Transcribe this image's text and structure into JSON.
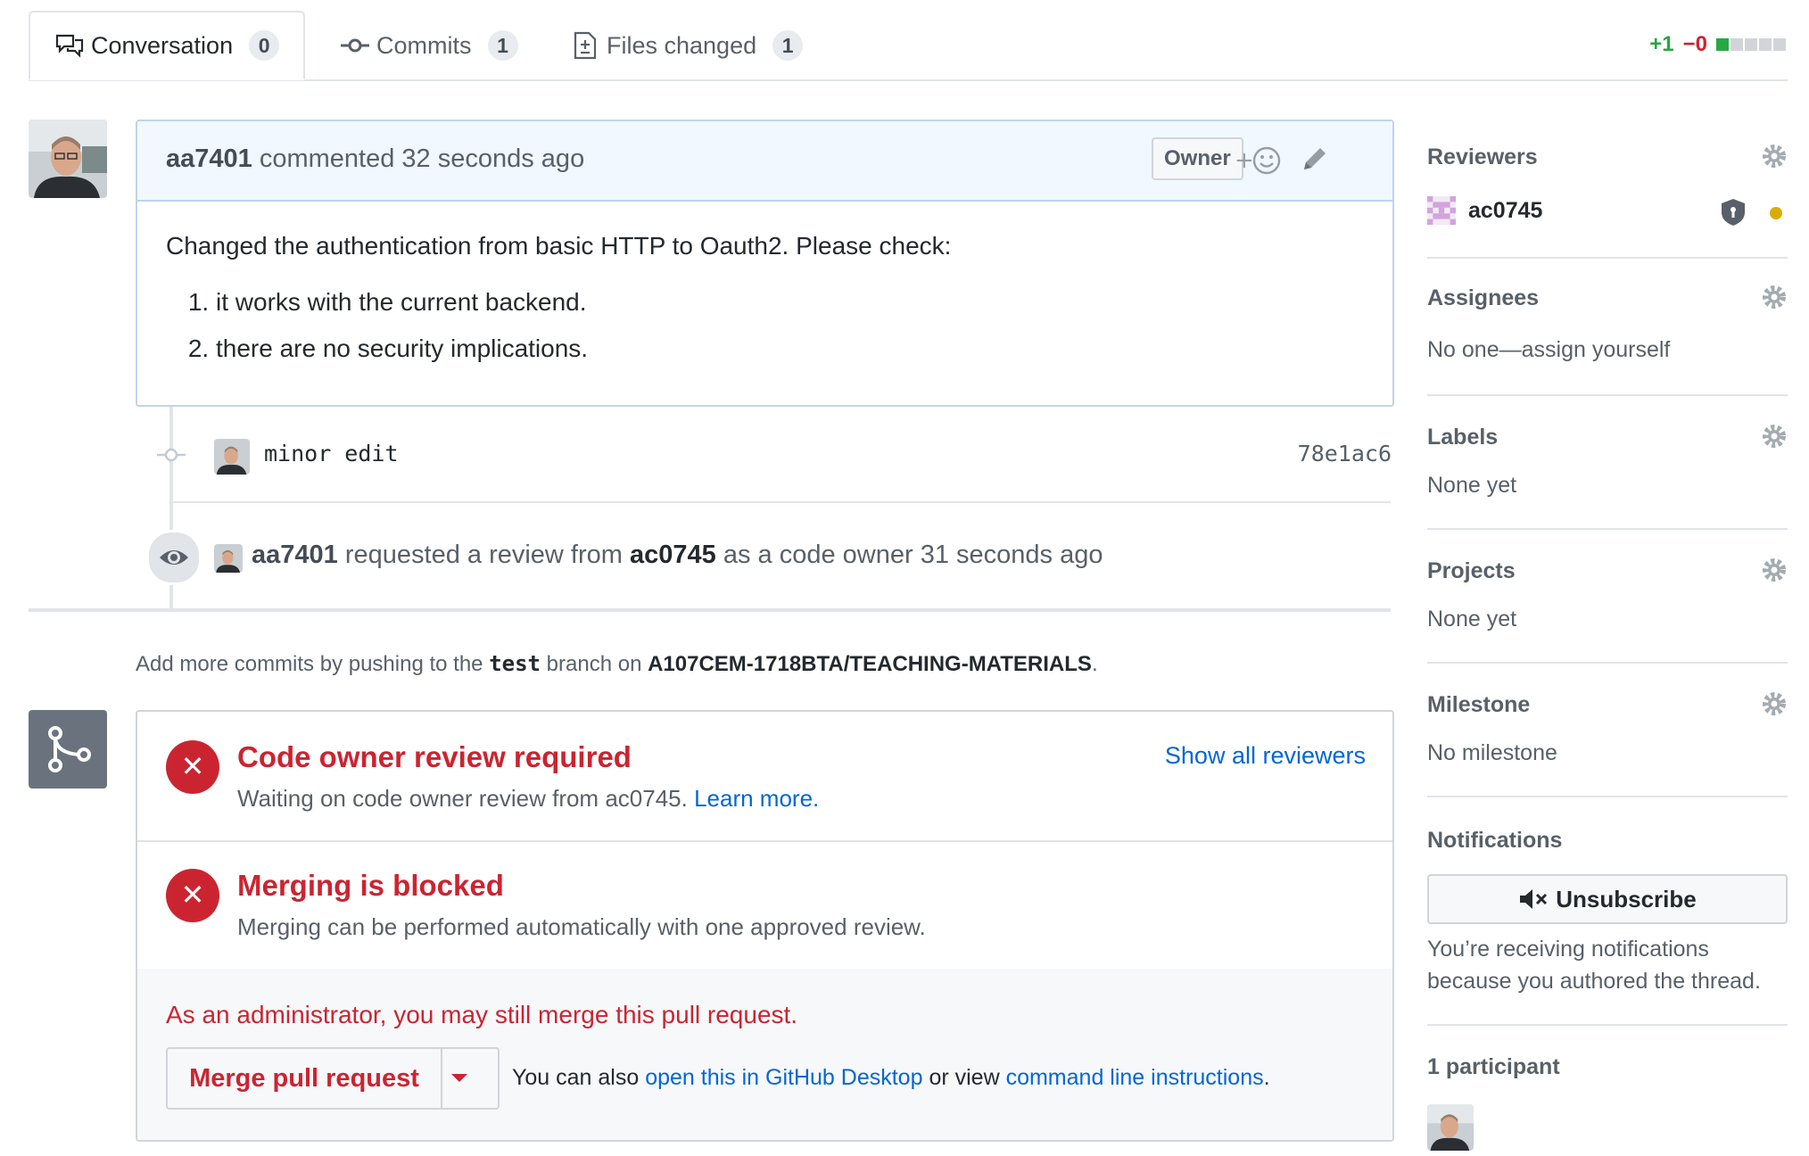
{
  "tabs": [
    {
      "label": "Conversation",
      "count": "0",
      "icon": "comment-discussion-icon"
    },
    {
      "label": "Commits",
      "count": "1",
      "icon": "commit-icon"
    },
    {
      "label": "Files changed",
      "count": "1",
      "icon": "file-diff-icon"
    }
  ],
  "diffstat": {
    "additions": "+1",
    "deletions": "−0"
  },
  "comment": {
    "author": "aa7401",
    "action": "commented",
    "time": "32 seconds ago",
    "badge": "Owner",
    "body_intro": "Changed the authentication from basic HTTP to Oauth2. Please check:",
    "items": [
      "it works with the current backend.",
      "there are no security implications."
    ]
  },
  "commit": {
    "message": "minor edit",
    "sha": "78e1ac6"
  },
  "review_event": {
    "author": "aa7401",
    "text_1": "requested a review from",
    "reviewer": "ac0745",
    "text_2": "as a code owner 31 seconds ago"
  },
  "push_hint": {
    "text_1": "Add more commits by pushing to the",
    "branch": "test",
    "text_2": "branch on",
    "repo": "A107CEM-1718BTA/TEACHING-MATERIALS",
    "text_3": "."
  },
  "merge": {
    "review_title": "Code owner review required",
    "review_desc": "Waiting on code owner review from ac0745.",
    "learn_more": "Learn more.",
    "show_reviewers": "Show all reviewers",
    "blocked_title": "Merging is blocked",
    "blocked_desc": "Merging can be performed automatically with one approved review.",
    "admin_note": "As an administrator, you may still merge this pull request.",
    "merge_button": "Merge pull request",
    "also_text": "You can also",
    "desktop_link": "open this in GitHub Desktop",
    "or_view": "or view",
    "cli_link": "command line instructions",
    "period": "."
  },
  "sidebar": {
    "reviewers": {
      "title": "Reviewers",
      "name": "ac0745"
    },
    "assignees": {
      "title": "Assignees",
      "text": "No one—assign yourself"
    },
    "labels": {
      "title": "Labels",
      "text": "None yet"
    },
    "projects": {
      "title": "Projects",
      "text": "None yet"
    },
    "milestone": {
      "title": "Milestone",
      "text": "No milestone"
    },
    "notifications": {
      "title": "Notifications",
      "button": "Unsubscribe",
      "line_1": "You’re receiving notifications",
      "line_2": "because you authored the thread."
    },
    "participants": {
      "title": "1 participant"
    }
  },
  "colors": {
    "danger": "#cb2431",
    "link": "#0366d6",
    "success": "#28a745",
    "pending": "#dbab09"
  }
}
